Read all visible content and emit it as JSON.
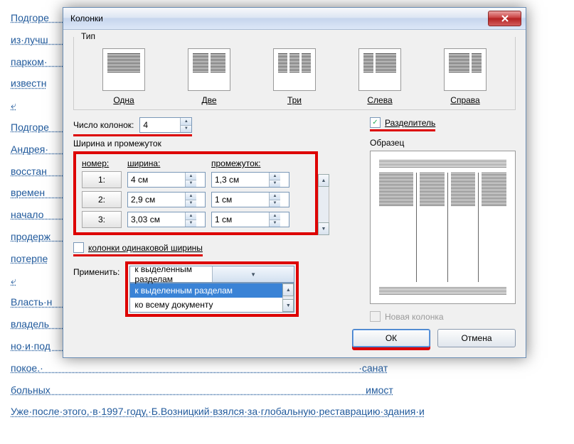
{
  "bg_text": "Подгоре                                                                                                                  чет·ме\nиз·лучш                                                                                                                  и-един\nпарком·                                                                                                                  ставля\nизвестн\n⤶\nПодгоре                                                                                                                  -Бопла\nАндрея·                                                                                                                  го·разр\nвосстан                                                                                                                  ых·дей\nвремен                                                                                                                  а·1651·\nначало                                                                                                                  ика,·но\nпродерж                                                                                                                  рации)\nпотерпе\n⤶\nВласть·н                                                                                                                  ими,·и\nвладель                                                                                                                  ториче\nно·и·под                                                                                                                  ·замо\nпокое.·                                                                                                                  ·санат\nбольных                                                                                                                  имост\nУже·после·этого,·в·1997·году,·Б.Возницкий·взялся·за·глобальную·реставрацию·здания·и",
  "dialog": {
    "title": "Колонки",
    "type_group": "Тип",
    "types": [
      {
        "label": "Одна",
        "cols": 1
      },
      {
        "label": "Две",
        "cols": 2
      },
      {
        "label": "Три",
        "cols": 3
      },
      {
        "label": "Слева",
        "cols": 2,
        "weights": [
          1,
          2
        ]
      },
      {
        "label": "Справа",
        "cols": 2,
        "weights": [
          2,
          1
        ]
      }
    ],
    "num_cols_label": "Число колонок:",
    "num_cols_value": "4",
    "divider_label": "Разделитель",
    "divider_checked": true,
    "width_group": "Ширина и промежуток",
    "table": {
      "headers": [
        "номер:",
        "ширина:",
        "промежуток:"
      ],
      "rows": [
        {
          "num": "1:",
          "width": "4 см",
          "gap": "1,3 см"
        },
        {
          "num": "2:",
          "width": "2,9 см",
          "gap": "1 см"
        },
        {
          "num": "3:",
          "width": "3,03 см",
          "gap": "1 см"
        }
      ]
    },
    "equal_width_label": "колонки одинаковой ширины",
    "equal_width_checked": false,
    "sample_label": "Образец",
    "apply_label": "Применить:",
    "apply_value": "к выделенным разделам",
    "apply_options": [
      "к выделенным разделам",
      "ко всему документу"
    ],
    "new_column_label": "Новая колонка",
    "new_column_enabled": false,
    "ok_label": "ОК",
    "cancel_label": "Отмена"
  }
}
